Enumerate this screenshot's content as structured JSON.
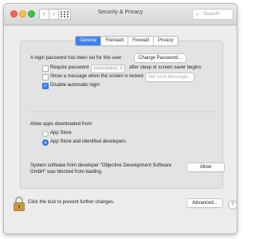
{
  "window": {
    "title": "Security & Privacy",
    "search_placeholder": "Search",
    "nav_back": "‹",
    "nav_forward": "›"
  },
  "tabs": [
    {
      "label": "General",
      "active": true
    },
    {
      "label": "FileVault",
      "active": false
    },
    {
      "label": "Firewall",
      "active": false
    },
    {
      "label": "Privacy",
      "active": false
    }
  ],
  "general": {
    "login_text": "A login password has been set for this user",
    "change_password_button": "Change Password...",
    "require_password": {
      "label": "Require password",
      "checked": false,
      "select_value": "immediately",
      "suffix": "after sleep or screen saver begins"
    },
    "show_message": {
      "label": "Show a message when the screen is locked",
      "checked": false,
      "button": "Set Lock Message..."
    },
    "disable_auto_login": {
      "label": "Disable automatic login",
      "checked": true
    },
    "allow_apps_label": "Allow apps downloaded from:",
    "options": [
      {
        "label": "App Store",
        "selected": false
      },
      {
        "label": "App Store and identified developers",
        "selected": true
      }
    ],
    "blocked_message_line1": "System software from developer \"Objective Development Software",
    "blocked_message_line2": "GmbH\" was blocked from loading.",
    "allow_button": "Allow"
  },
  "footer": {
    "lock_text": "Click the lock to prevent further changes.",
    "advanced_button": "Advanced...",
    "help_button": "?"
  },
  "colors": {
    "accent": "#3b82f0",
    "window_bg": "#ececec",
    "panel_bg": "#e3e3e3"
  }
}
